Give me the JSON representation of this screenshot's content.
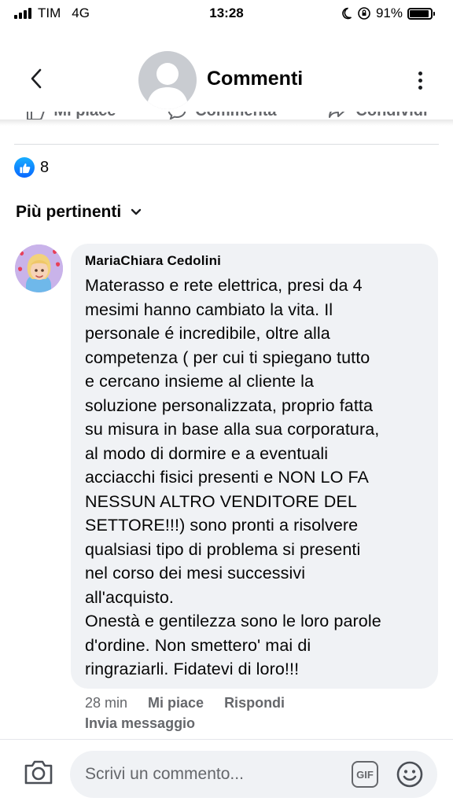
{
  "status_bar": {
    "carrier": "TIM",
    "network": "4G",
    "time": "13:28",
    "battery": "91%",
    "battery_level": 0.91
  },
  "header": {
    "title": "Commenti",
    "back_icon": "chevron-left-icon",
    "more_icon": "vertical-ellipsis-icon"
  },
  "actions": [
    {
      "label": "Mi piace",
      "icon": "thumbs-up-outline-icon"
    },
    {
      "label": "Commenta",
      "icon": "comment-bubble-icon"
    },
    {
      "label": "Condividi",
      "icon": "share-arrow-icon"
    }
  ],
  "reactions": {
    "count": "8",
    "icon": "like-reaction-icon"
  },
  "sort": {
    "label": "Più pertinenti",
    "icon": "chevron-down-icon"
  },
  "comment": {
    "author": "MariaChiara Cedolini",
    "text": "Materasso e rete elettrica, presi da 4\nmesimi hanno cambiato la vita. Il\npersonale é incredibile, oltre alla\ncompetenza ( per cui ti spiegano tutto\ne cercano insieme al cliente la\nsoluzione personalizzata, proprio fatta\nsu misura in base alla sua corporatura,\nal modo di dormire e a eventuali\nacciacchi fisici presenti e NON LO FA\nNESSUN ALTRO VENDITORE DEL\nSETTORE!!!) sono pronti a risolvere\nqualsiasi tipo di problema si presenti\nnel corso dei mesi successivi\nall'acquisto.\nOnestà e gentilezza sono le loro parole\nd'ordine. Non smettero' mai di\nringraziarli. Fidatevi di loro!!!",
    "time": "28 min",
    "like_label": "Mi piace",
    "reply_label": "Rispondi",
    "send_message_label": "Invia messaggio"
  },
  "composer": {
    "placeholder": "Scrivi un commento...",
    "gif_label": "GIF",
    "camera_icon": "camera-icon",
    "emoji_icon": "smiley-icon"
  },
  "colors": {
    "accent_blue": "#0866ff",
    "secondary_text": "#65676b",
    "bubble_bg": "#f0f2f5"
  }
}
